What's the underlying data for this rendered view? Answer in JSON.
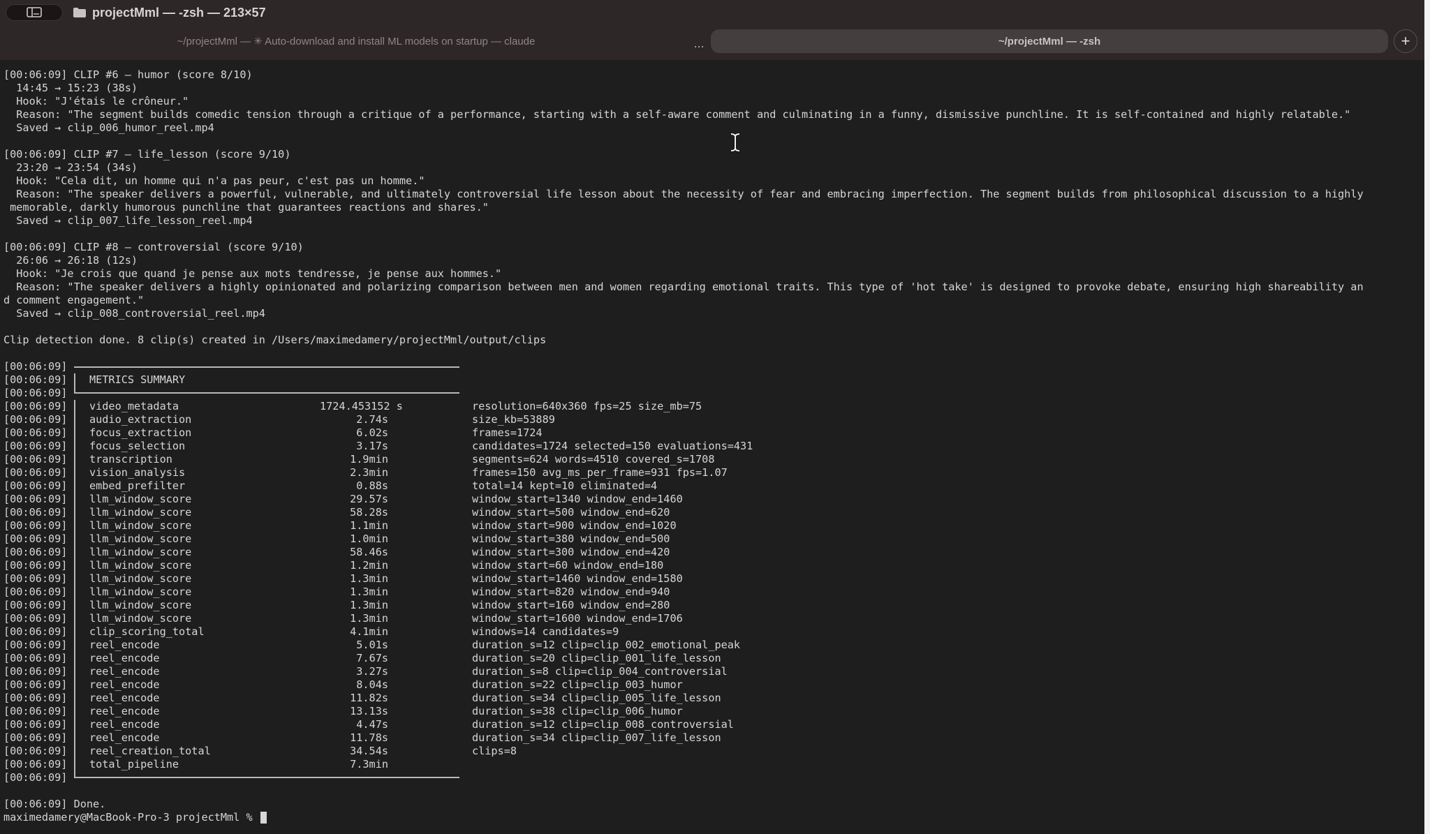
{
  "window": {
    "title": "projectMml — -zsh — 213×57"
  },
  "tabs": [
    {
      "label": "~/projectMml — ✳ Auto-download and install ML models on startup — claude",
      "active": false
    },
    {
      "label": "~/projectMml — -zsh",
      "active": true
    }
  ],
  "tab_overflow": "...",
  "new_tab": "+",
  "clips": [
    {
      "header": "[00:06:09] CLIP #6 — humor (score 8/10)",
      "range": "  14:45 → 15:23 (38s)",
      "hook": "  Hook: \"J'étais le crôneur.\"",
      "reason": [
        "  Reason: \"The segment builds comedic tension through a critique of a performance, starting with a self-aware comment and culminating in a funny, dismissive punchline. It is self-contained and highly relatable.\""
      ],
      "saved": "  Saved → clip_006_humor_reel.mp4"
    },
    {
      "header": "[00:06:09] CLIP #7 — life_lesson (score 9/10)",
      "range": "  23:20 → 23:54 (34s)",
      "hook": "  Hook: \"Cela dit, un homme qui n'a pas peur, c'est pas un homme.\"",
      "reason": [
        "  Reason: \"The speaker delivers a powerful, vulnerable, and ultimately controversial life lesson about the necessity of fear and embracing imperfection. The segment builds from philosophical discussion to a highly",
        " memorable, darkly humorous punchline that guarantees reactions and shares.\""
      ],
      "saved": "  Saved → clip_007_life_lesson_reel.mp4"
    },
    {
      "header": "[00:06:09] CLIP #8 — controversial (score 9/10)",
      "range": "  26:06 → 26:18 (12s)",
      "hook": "  Hook: \"Je crois que quand je pense aux mots tendresse, je pense aux hommes.\"",
      "reason": [
        "  Reason: \"The speaker delivers a highly opinionated and polarizing comparison between men and women regarding emotional traits. This type of 'hot take' is designed to provoke debate, ensuring high shareability an",
        "d comment engagement.\""
      ],
      "saved": "  Saved → clip_008_controversial_reel.mp4"
    }
  ],
  "detection_done": "Clip detection done. 8 clip(s) created in /Users/maximedamery/projectMml/output/clips",
  "timestamp": "[00:06:09]",
  "summary_title": "METRICS SUMMARY",
  "metrics": [
    {
      "name": "video_metadata",
      "time": "1724.453152 s",
      "detail": "resolution=640x360 fps=25 size_mb=75"
    },
    {
      "name": "audio_extraction",
      "time": "2.74s",
      "detail": "size_kb=53889"
    },
    {
      "name": "focus_extraction",
      "time": "6.02s",
      "detail": "frames=1724"
    },
    {
      "name": "focus_selection",
      "time": "3.17s",
      "detail": "candidates=1724 selected=150 evaluations=431"
    },
    {
      "name": "transcription",
      "time": "1.9min",
      "detail": "segments=624 words=4510 covered_s=1708"
    },
    {
      "name": "vision_analysis",
      "time": "2.3min",
      "detail": "frames=150 avg_ms_per_frame=931 fps=1.07"
    },
    {
      "name": "embed_prefilter",
      "time": "0.88s",
      "detail": "total=14 kept=10 eliminated=4"
    },
    {
      "name": "llm_window_score",
      "time": "29.57s",
      "detail": "window_start=1340 window_end=1460"
    },
    {
      "name": "llm_window_score",
      "time": "58.28s",
      "detail": "window_start=500 window_end=620"
    },
    {
      "name": "llm_window_score",
      "time": "1.1min",
      "detail": "window_start=900 window_end=1020"
    },
    {
      "name": "llm_window_score",
      "time": "1.0min",
      "detail": "window_start=380 window_end=500"
    },
    {
      "name": "llm_window_score",
      "time": "58.46s",
      "detail": "window_start=300 window_end=420"
    },
    {
      "name": "llm_window_score",
      "time": "1.2min",
      "detail": "window_start=60 window_end=180"
    },
    {
      "name": "llm_window_score",
      "time": "1.3min",
      "detail": "window_start=1460 window_end=1580"
    },
    {
      "name": "llm_window_score",
      "time": "1.3min",
      "detail": "window_start=820 window_end=940"
    },
    {
      "name": "llm_window_score",
      "time": "1.3min",
      "detail": "window_start=160 window_end=280"
    },
    {
      "name": "llm_window_score",
      "time": "1.3min",
      "detail": "window_start=1600 window_end=1706"
    },
    {
      "name": "clip_scoring_total",
      "time": "4.1min",
      "detail": "windows=14 candidates=9"
    },
    {
      "name": "reel_encode",
      "time": "5.01s",
      "detail": "duration_s=12 clip=clip_002_emotional_peak"
    },
    {
      "name": "reel_encode",
      "time": "7.67s",
      "detail": "duration_s=20 clip=clip_001_life_lesson"
    },
    {
      "name": "reel_encode",
      "time": "3.27s",
      "detail": "duration_s=8 clip=clip_004_controversial"
    },
    {
      "name": "reel_encode",
      "time": "8.04s",
      "detail": "duration_s=22 clip=clip_003_humor"
    },
    {
      "name": "reel_encode",
      "time": "11.82s",
      "detail": "duration_s=34 clip=clip_005_life_lesson"
    },
    {
      "name": "reel_encode",
      "time": "13.13s",
      "detail": "duration_s=38 clip=clip_006_humor"
    },
    {
      "name": "reel_encode",
      "time": "4.47s",
      "detail": "duration_s=12 clip=clip_008_controversial"
    },
    {
      "name": "reel_encode",
      "time": "11.78s",
      "detail": "duration_s=34 clip=clip_007_life_lesson"
    },
    {
      "name": "reel_creation_total",
      "time": "34.54s",
      "detail": "clips=8"
    },
    {
      "name": "total_pipeline",
      "time": "7.3min",
      "detail": ""
    }
  ],
  "done_line": "[00:06:09] Done.",
  "prompt": "maximedamery@MacBook-Pro-3 projectMml % "
}
